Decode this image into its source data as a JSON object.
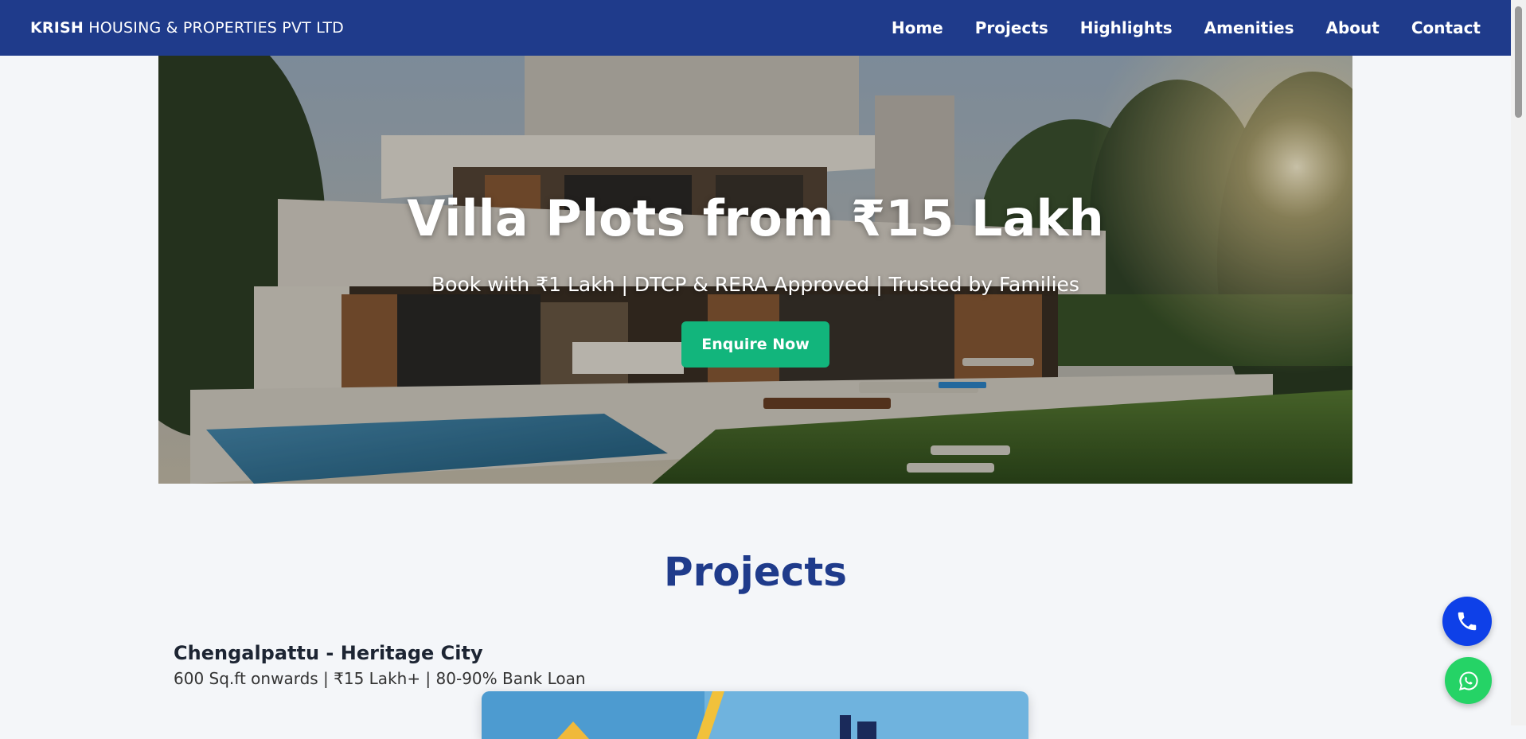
{
  "brand": {
    "bold": "KRISH",
    "rest": " HOUSING & PROPERTIES PVT LTD"
  },
  "nav": {
    "items": [
      {
        "label": "Home"
      },
      {
        "label": "Projects"
      },
      {
        "label": "Highlights"
      },
      {
        "label": "Amenities"
      },
      {
        "label": "About"
      },
      {
        "label": "Contact"
      }
    ]
  },
  "hero": {
    "title": "Villa Plots from ₹15 Lakh",
    "subtitle": "Book with ₹1 Lakh | DTCP & RERA Approved | Trusted by Families",
    "cta_label": "Enquire Now"
  },
  "projects": {
    "heading": "Projects",
    "items": [
      {
        "title": "Chengalpattu - Heritage City",
        "meta": "600 Sq.ft onwards | ₹15 Lakh+ | 80-90% Bank Loan"
      }
    ]
  },
  "floating": {
    "call_icon": "phone-icon",
    "whatsapp_icon": "whatsapp-icon"
  },
  "colors": {
    "nav": "#1f3b8b",
    "accent": "#12b57c",
    "heading": "#1f3b8b",
    "call": "#0e40e8",
    "whatsapp": "#25d366"
  }
}
